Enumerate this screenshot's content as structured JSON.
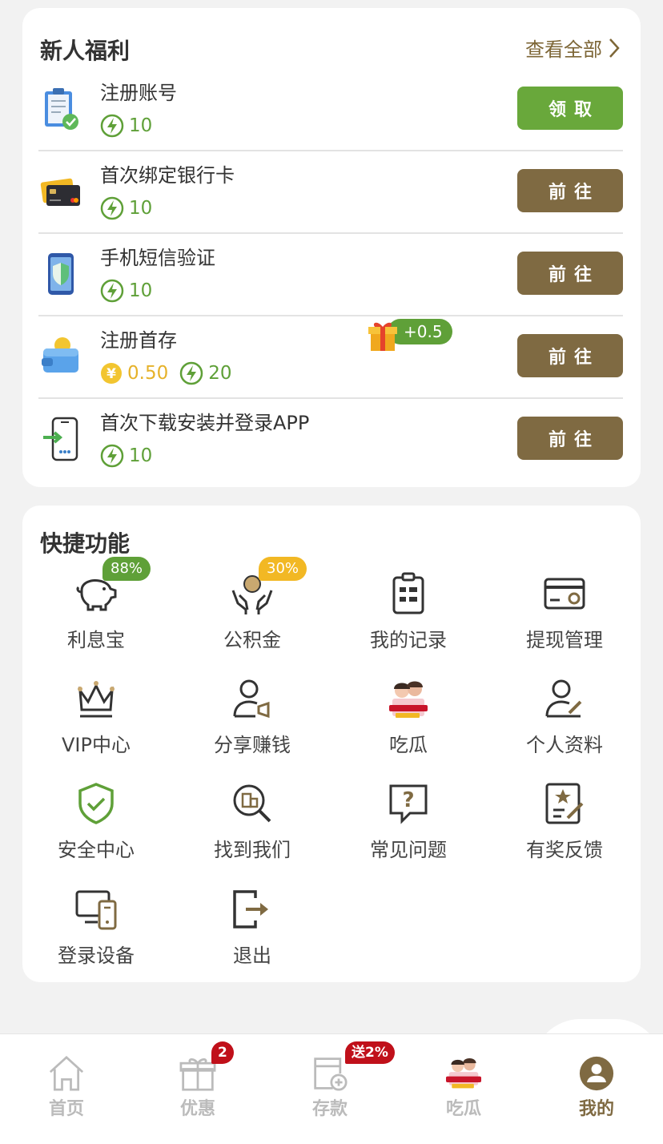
{
  "welfare": {
    "title": "新人福利",
    "view_all": "查看全部",
    "tasks": [
      {
        "name": "注册账号",
        "points": "10",
        "button": "领取",
        "icon": "clipboard-check-icon"
      },
      {
        "name": "首次绑定银行卡",
        "points": "10",
        "button": "前往",
        "icon": "bank-card-icon"
      },
      {
        "name": "手机短信验证",
        "points": "10",
        "button": "前往",
        "icon": "phone-shield-icon"
      },
      {
        "name": "注册首存",
        "coin": "0.50",
        "points": "20",
        "button": "前往",
        "icon": "wallet-icon",
        "gift_bonus": "+0.5"
      },
      {
        "name": "首次下载安装并登录APP",
        "points": "10",
        "button": "前往",
        "icon": "phone-login-icon"
      }
    ]
  },
  "quick": {
    "title": "快捷功能",
    "items": [
      {
        "label": "利息宝",
        "badge": "88%"
      },
      {
        "label": "公积金",
        "badge": "30%"
      },
      {
        "label": "我的记录"
      },
      {
        "label": "提现管理"
      },
      {
        "label": "VIP中心"
      },
      {
        "label": "分享赚钱"
      },
      {
        "label": "吃瓜"
      },
      {
        "label": "个人资料"
      },
      {
        "label": "安全中心"
      },
      {
        "label": "找到我们"
      },
      {
        "label": "常见问题"
      },
      {
        "label": "有奖反馈"
      },
      {
        "label": "登录设备"
      },
      {
        "label": "退出"
      }
    ]
  },
  "nav": {
    "items": [
      {
        "label": "首页"
      },
      {
        "label": "优惠",
        "badge": "2"
      },
      {
        "label": "存款",
        "badge": "送2%"
      },
      {
        "label": "吃瓜"
      },
      {
        "label": "我的"
      }
    ]
  },
  "colors": {
    "accent_brown": "#7f6a42",
    "accent_green": "#69a83b",
    "coin_gold": "#e6b22a"
  }
}
